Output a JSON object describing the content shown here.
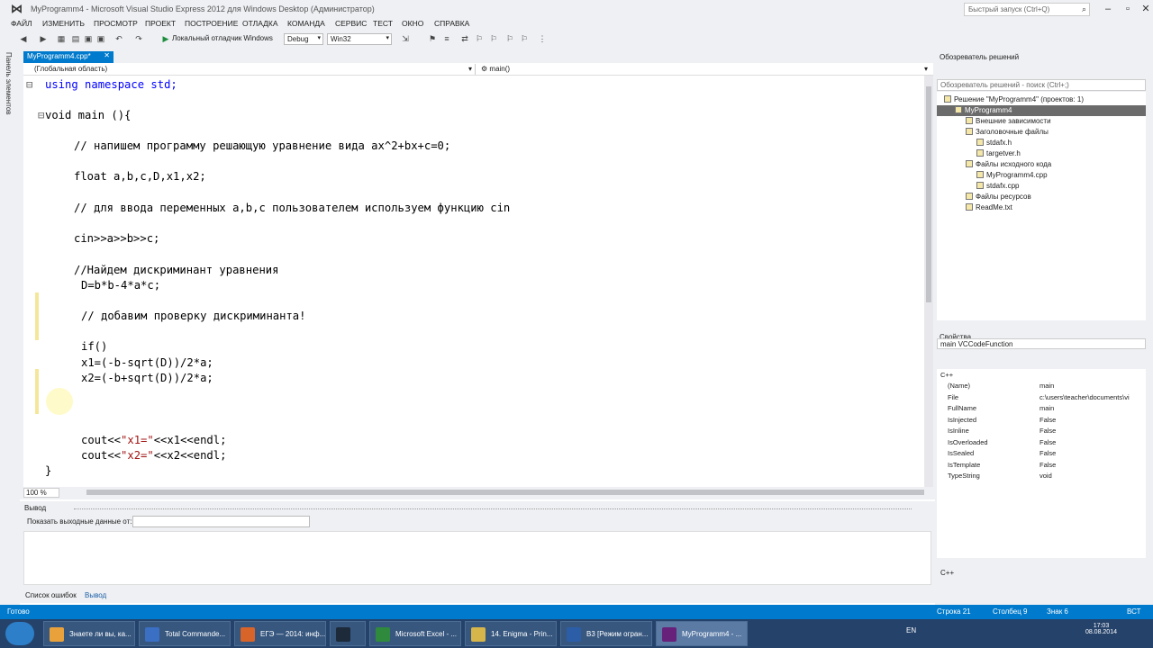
{
  "window": {
    "title": "MyProgramm4 - Microsoft Visual Studio Express 2012 для Windows Desktop (Администратор)",
    "quick_launch_placeholder": "Быстрый запуск (Ctrl+Q)"
  },
  "menu": [
    "ФАЙЛ",
    "ИЗМЕНИТЬ",
    "ПРОСМОТР",
    "ПРОЕКТ",
    "ПОСТРОЕНИЕ",
    "ОТЛАДКА",
    "КОМАНДА",
    "СЕРВИС",
    "ТЕСТ",
    "ОКНО",
    "СПРАВКА"
  ],
  "toolbar": {
    "debugger": "Локальный отладчик Windows",
    "config": "Debug",
    "platform": "Win32"
  },
  "left_strip": "Панель элементов",
  "editor": {
    "tab": "MyProgramm4.cpp*",
    "scope": "(Глобальная область)",
    "member": "main()",
    "zoom": "100 %"
  },
  "code": {
    "l1": "using namespace std;",
    "l2": "void main (){",
    "l3": "// напишем программу решающую уравнение вида ax^2+bx+c=0;",
    "l4": "float a,b,c,D,x1,x2;",
    "l5": "// для ввода переменных a,b,c пользователем используем функцию cin",
    "l6": "cin>>a>>b>>c;",
    "l7": "//Найдем дискриминант уравнения",
    "l8": "D=b*b-4*a*c;",
    "l9": "// добавим проверку дискриминанта!",
    "l10": "if()",
    "l11": "x1=(-b-sqrt(D))/2*a;",
    "l12": "x2=(-b+sqrt(D))/2*a;",
    "l13_a": "cout<<",
    "l13_s": "\"x1=\"",
    "l13_b": "<<x1<<endl;",
    "l14_a": "cout<<",
    "l14_s": "\"x2=\"",
    "l14_b": "<<x2<<endl;",
    "l15": "}"
  },
  "output": {
    "title": "Вывод",
    "show_label": "Показать выходные данные от:"
  },
  "bottom_tabs": [
    "Список ошибок",
    "Вывод"
  ],
  "solution_explorer": {
    "title": "Обозреватель решений",
    "search": "Обозреватель решений - поиск (Ctrl+;)",
    "items": [
      "Решение \"MyProgramm4\" (проектов: 1)",
      "MyProgramm4",
      "Внешние зависимости",
      "Заголовочные файлы",
      "stdafx.h",
      "targetver.h",
      "Файлы исходного кода",
      "MyProgramm4.cpp",
      "stdafx.cpp",
      "Файлы ресурсов",
      "ReadMe.txt"
    ]
  },
  "properties": {
    "title": "Свойства",
    "object": "main",
    "object_type": "VCCodeFunction",
    "category": "C++",
    "rows": [
      {
        "name": "(Name)",
        "value": "main"
      },
      {
        "name": "File",
        "value": "c:\\users\\teacher\\documents\\vi"
      },
      {
        "name": "FullName",
        "value": "main"
      },
      {
        "name": "IsInjected",
        "value": "False"
      },
      {
        "name": "IsInline",
        "value": "False"
      },
      {
        "name": "IsOverloaded",
        "value": "False"
      },
      {
        "name": "IsSealed",
        "value": "False"
      },
      {
        "name": "IsTemplate",
        "value": "False"
      },
      {
        "name": "TypeString",
        "value": "void"
      }
    ],
    "desc": "C++"
  },
  "status": {
    "ready": "Готово",
    "line": "Строка 21",
    "col": "Столбец 9",
    "ch": "Знак 6",
    "mode": "ВСТ"
  },
  "taskbar": {
    "tasks": [
      "Знаете ли вы, ка...",
      "Total Commande...",
      "ЕГЭ — 2014: инф...",
      "",
      "Microsoft Excel - ...",
      "14. Enigma - Prin...",
      "В3 [Режим огран...",
      "MyProgramm4 - ..."
    ],
    "lang": "EN",
    "time": "17:03",
    "date": "08.08.2014"
  },
  "colors": {
    "accent": "#007acc",
    "keyword": "#0000ff",
    "comment": "#008000",
    "string": "#a31515"
  }
}
